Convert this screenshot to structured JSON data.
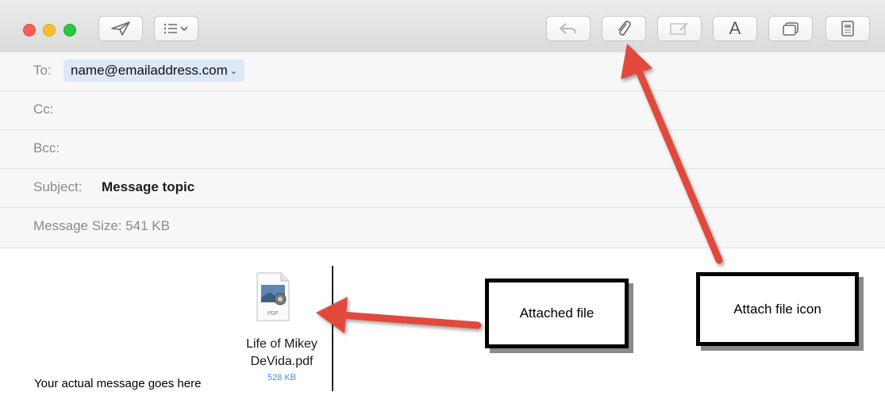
{
  "toolbar": {
    "buttons": [
      {
        "name": "send",
        "icon": "paper-plane-icon"
      },
      {
        "name": "header-fields-menu",
        "icon": "list-chevron-icon"
      },
      {
        "name": "reply",
        "icon": "reply-arrow-icon",
        "enabled": false
      },
      {
        "name": "attach",
        "icon": "paperclip-icon"
      },
      {
        "name": "markup",
        "icon": "markup-photo-icon",
        "enabled": false
      },
      {
        "name": "format",
        "icon": "font-a-icon",
        "glyph": "A"
      },
      {
        "name": "photo-browser",
        "icon": "window-icon"
      },
      {
        "name": "stationery",
        "icon": "stationery-icon"
      }
    ]
  },
  "header": {
    "to": {
      "label": "To:",
      "value": "name@emailaddress.com",
      "chevron": "⌄"
    },
    "cc": {
      "label": "Cc:"
    },
    "bcc": {
      "label": "Bcc:"
    },
    "subject": {
      "label": "Subject:",
      "value": "Message topic"
    },
    "size": {
      "label": "Message Size: 541 KB"
    }
  },
  "attachment": {
    "type_label": "PDF",
    "name_line1": "Life of Mikey",
    "name_line2": "DeVida.pdf",
    "size": "528 KB"
  },
  "body": {
    "message": "Your actual message goes here"
  },
  "annotations": {
    "attached_file": "Attached file",
    "attach_file_icon": "Attach file icon",
    "arrow_color": "#e0483a"
  }
}
